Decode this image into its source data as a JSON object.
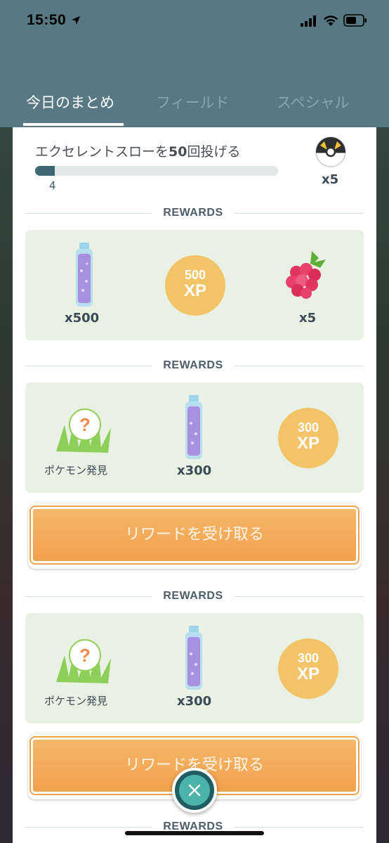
{
  "status_bar": {
    "time": "15:50"
  },
  "tabs": [
    {
      "label": "今日のまとめ",
      "active": true
    },
    {
      "label": "フィールド",
      "active": false
    },
    {
      "label": "スペシャル",
      "active": false
    }
  ],
  "quest": {
    "title_prefix": "エクセレントスローを",
    "title_number": "50",
    "title_suffix": "回投げる",
    "progress_value": "4",
    "progress_fraction": 0.08,
    "reward_icon": "ultra-ball-icon",
    "reward_count": "x5"
  },
  "reward_sections": [
    {
      "header": "REWARDS",
      "items": [
        {
          "icon": "stardust-bottle-icon",
          "label": "x500"
        },
        {
          "icon": "xp-badge",
          "xp_number": "500",
          "xp_unit": "XP"
        },
        {
          "icon": "razz-berry-icon",
          "label": "x5"
        }
      ]
    },
    {
      "header": "REWARDS",
      "items": [
        {
          "icon": "pokemon-encounter-icon",
          "caption": "ポケモン発見"
        },
        {
          "icon": "stardust-bottle-icon",
          "label": "x300"
        },
        {
          "icon": "xp-badge",
          "xp_number": "300",
          "xp_unit": "XP"
        }
      ],
      "button": "リワードを受け取る"
    },
    {
      "header": "REWARDS",
      "items": [
        {
          "icon": "pokemon-encounter-icon",
          "caption": "ポケモン発見"
        },
        {
          "icon": "stardust-bottle-icon",
          "label": "x300"
        },
        {
          "icon": "xp-badge",
          "xp_number": "300",
          "xp_unit": "XP"
        }
      ],
      "button": "リワードを受け取る"
    },
    {
      "header": "REWARDS"
    }
  ],
  "colors": {
    "header_bg": "#587983",
    "reward_bg": "#e8f1e3",
    "xp_badge": "#f2c467",
    "button_orange": "#f0a24c",
    "progress_fill": "#3f6673"
  }
}
